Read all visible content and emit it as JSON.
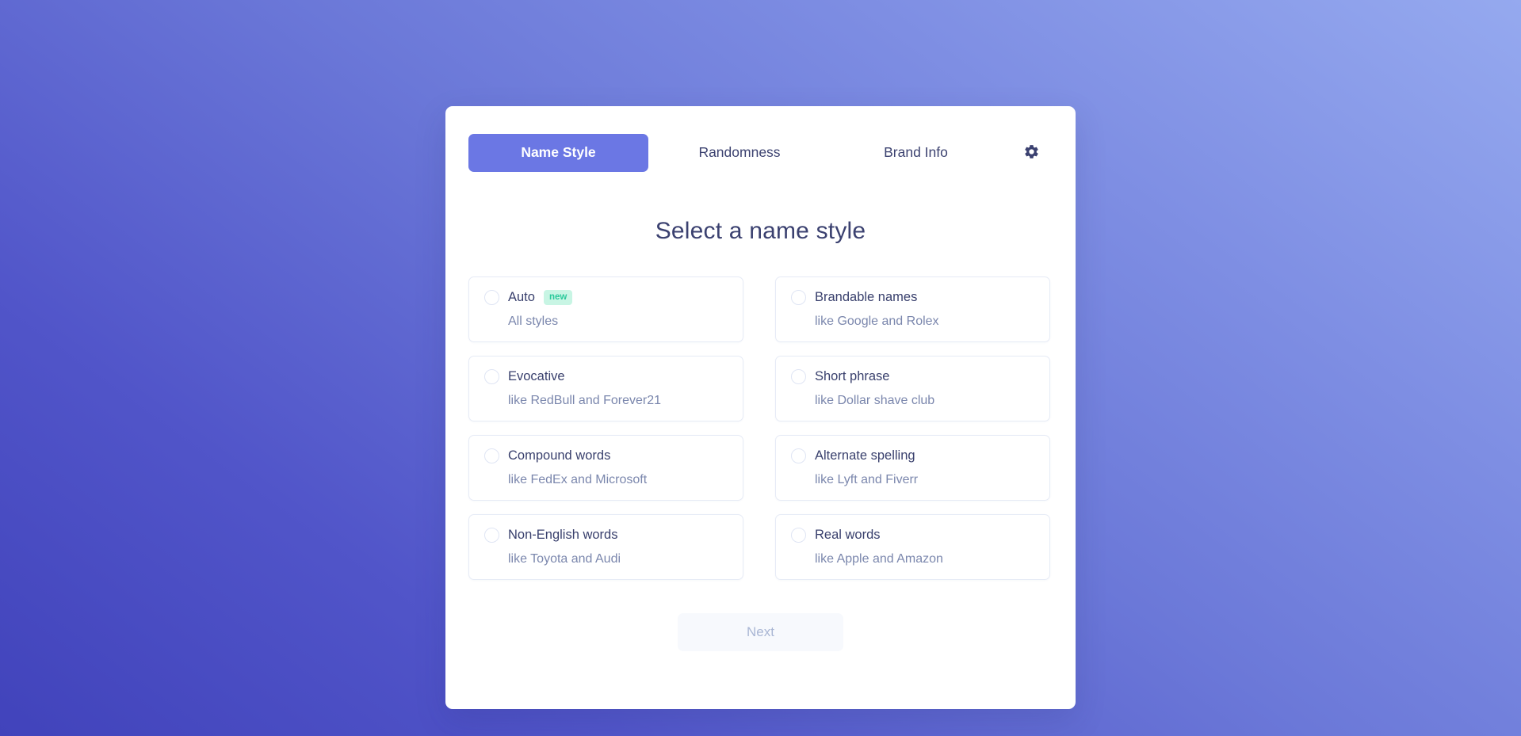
{
  "tabs": [
    {
      "label": "Name Style",
      "active": true,
      "name": "tab-name-style"
    },
    {
      "label": "Randomness",
      "active": false,
      "name": "tab-randomness"
    },
    {
      "label": "Brand Info",
      "active": false,
      "name": "tab-brand-info"
    }
  ],
  "settings_icon": "gear-icon",
  "heading": "Select a name style",
  "options": [
    {
      "label": "Auto",
      "badge": "new",
      "desc": "All styles",
      "selected": false
    },
    {
      "label": "Brandable names",
      "badge": null,
      "desc": "like Google and Rolex",
      "selected": false
    },
    {
      "label": "Evocative",
      "badge": null,
      "desc": "like RedBull and Forever21",
      "selected": false
    },
    {
      "label": "Short phrase",
      "badge": null,
      "desc": "like Dollar shave club",
      "selected": false
    },
    {
      "label": "Compound words",
      "badge": null,
      "desc": "like FedEx and Microsoft",
      "selected": false
    },
    {
      "label": "Alternate spelling",
      "badge": null,
      "desc": "like Lyft and Fiverr",
      "selected": false
    },
    {
      "label": "Non-English words",
      "badge": null,
      "desc": "like Toyota and Audi",
      "selected": false
    },
    {
      "label": "Real words",
      "badge": null,
      "desc": "like Apple and Amazon",
      "selected": false
    }
  ],
  "next_button": {
    "label": "Next",
    "disabled": true
  },
  "colors": {
    "accent": "#6b77e4",
    "heading_text": "#3b4170",
    "label_text": "#39406d",
    "desc_text": "#7b87ad",
    "badge_bg": "#c8f5e4",
    "badge_text": "#2bc99b",
    "card_border": "#e6ebf6",
    "next_bg": "#f7f9fd",
    "next_text": "#a9b6d4",
    "bg_gradient_start": "#4143bb",
    "bg_gradient_end": "#95a9ef"
  }
}
